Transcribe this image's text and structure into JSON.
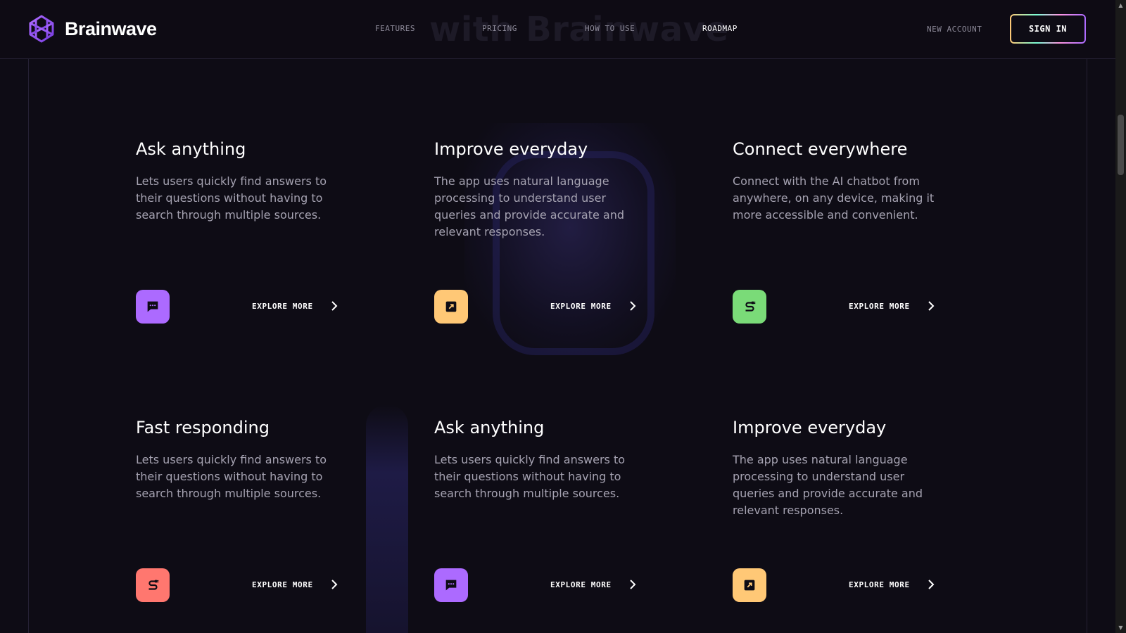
{
  "brand": {
    "name": "Brainwave"
  },
  "header": {
    "ghost_heading": "with Brainwave",
    "nav": [
      {
        "label": "FEATURES",
        "active": false
      },
      {
        "label": "PRICING",
        "active": false
      },
      {
        "label": "HOW TO USE",
        "active": false
      },
      {
        "label": "ROADMAP",
        "active": true
      }
    ],
    "new_account": "NEW ACCOUNT",
    "sign_in": "SIGN IN"
  },
  "cards": [
    {
      "title": "Ask anything",
      "text": "Lets users quickly find answers to their questions without having to search through multiple sources.",
      "icon": "chat-bubble-icon",
      "icon_bg": "#ac6aff",
      "cta": "EXPLORE MORE"
    },
    {
      "title": "Improve everyday",
      "text": "The app uses natural language processing to understand user queries and provide accurate and relevant responses.",
      "icon": "expand-arrow-icon",
      "icon_bg": "#ffc876",
      "cta": "EXPLORE MORE"
    },
    {
      "title": "Connect everywhere",
      "text": "Connect with the AI chatbot from anywhere, on any device, making it more accessible and convenient.",
      "icon": "plug-icon",
      "icon_bg": "#7adb78",
      "cta": "EXPLORE MORE"
    },
    {
      "title": "Fast responding",
      "text": "Lets users quickly find answers to their questions without having to search through multiple sources.",
      "icon": "plug-icon",
      "icon_bg": "#ff776f",
      "cta": "EXPLORE MORE"
    },
    {
      "title": "Ask anything",
      "text": "Lets users quickly find answers to their questions without having to search through multiple sources.",
      "icon": "chat-bubble-icon",
      "icon_bg": "#ac6aff",
      "cta": "EXPLORE MORE"
    },
    {
      "title": "Improve everyday",
      "text": "The app uses natural language processing to understand user queries and provide accurate and relevant responses.",
      "icon": "expand-arrow-icon",
      "icon_bg": "#ffc876",
      "cta": "EXPLORE MORE"
    }
  ]
}
